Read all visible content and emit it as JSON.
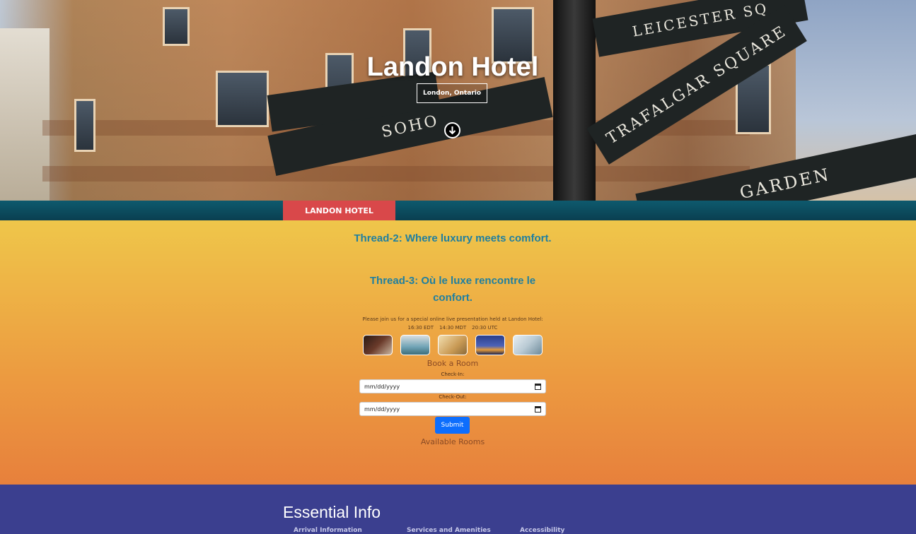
{
  "hero": {
    "title": "Landon Hotel",
    "subtitle": "London, Ontario",
    "signs": [
      "LEICESTER SQ",
      "TRAFALGAR SQUARE",
      "SOHO",
      "GARDEN"
    ]
  },
  "nav": {
    "tab_label": "LANDON HOTEL"
  },
  "main": {
    "tagline_1": "Thread-2: Where luxury meets comfort.",
    "tagline_2": "Thread-3: Où le luxe rencontre le confort.",
    "note": "Please join us for a special online live presentation held at Landon Hotel:",
    "times": [
      "16:30 EDT",
      "14:30 MDT",
      "20:30 UTC"
    ],
    "book_title": "Book a Room",
    "checkin_label": "Check-In:",
    "checkout_label": "Check-Out:",
    "checkin_placeholder": "mm/dd/yyyy",
    "checkout_placeholder": "mm/dd/yyyy",
    "submit_label": "Submit",
    "available_rooms": "Available Rooms"
  },
  "footer": {
    "heading": "Essential Info",
    "links": [
      "Arrival Information",
      "Services and Amenities",
      "Accessibility"
    ]
  },
  "colors": {
    "accent_red": "#d9484a",
    "nav_teal": "#0a3f50",
    "tagline_blue": "#1f7fa0",
    "submit_blue": "#0d6efd",
    "footer_blue": "#3b3f8f"
  }
}
